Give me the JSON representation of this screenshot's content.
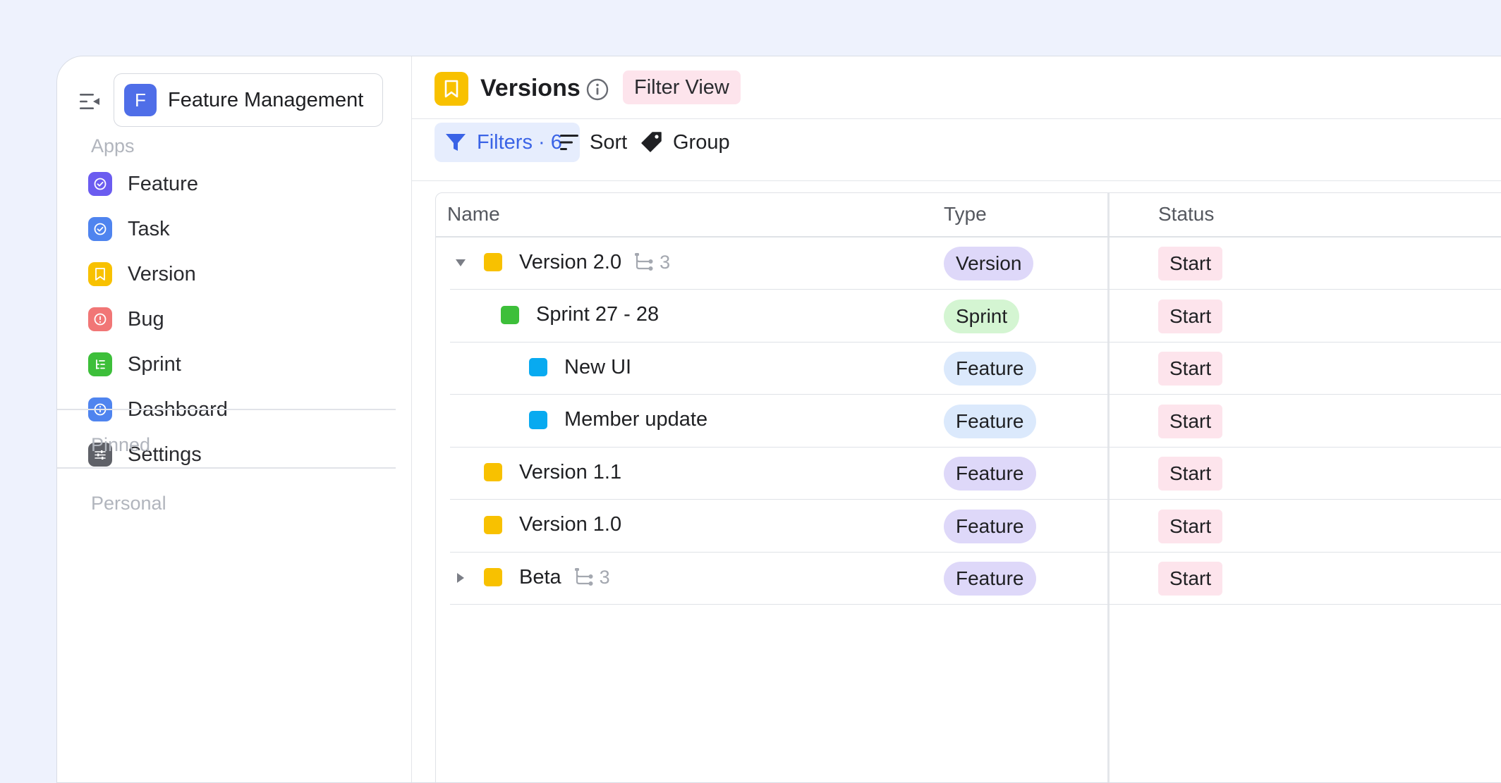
{
  "workspace": {
    "initial": "F",
    "name": "Feature Management"
  },
  "sidebar": {
    "apps_label": "Apps",
    "items": [
      {
        "label": "Feature",
        "icon": "check-circle-icon",
        "color": "#6b5cf0"
      },
      {
        "label": "Task",
        "icon": "check-circle-icon",
        "color": "#4f84ef"
      },
      {
        "label": "Version",
        "icon": "bookmark-icon",
        "color": "#f8c100"
      },
      {
        "label": "Bug",
        "icon": "alert-circle-icon",
        "color": "#f17676"
      },
      {
        "label": "Sprint",
        "icon": "sprint-list-icon",
        "color": "#3dbf3a"
      },
      {
        "label": "Dashboard",
        "icon": "info-circle-icon",
        "color": "#4f84ef"
      },
      {
        "label": "Settings",
        "icon": "sliders-icon",
        "color": "#5f6168"
      }
    ],
    "pinned_label": "Pinned",
    "personal_label": "Personal"
  },
  "header": {
    "title": "Versions",
    "filter_view": "Filter View"
  },
  "toolbar": {
    "filters": "Filters · 6",
    "sort": "Sort",
    "group": "Group"
  },
  "table": {
    "columns": [
      "Name",
      "Type",
      "Status"
    ],
    "rows": [
      {
        "name": "Version 2.0",
        "square": "#f8c100",
        "expanded": true,
        "subcount": "3",
        "type": "Version",
        "type_color": "#ded8f9",
        "status": "Start"
      },
      {
        "name": "Sprint 27 - 28",
        "square": "#3dbf3a",
        "type": "Sprint",
        "type_color": "#d4f5d2",
        "status": "Start"
      },
      {
        "name": "New UI",
        "square": "#08aaf0",
        "type": "Feature",
        "type_color": "#dbe9fc",
        "status": "Start"
      },
      {
        "name": "Member update",
        "square": "#08aaf0",
        "type": "Feature",
        "type_color": "#dbe9fc",
        "status": "Start"
      },
      {
        "name": "Version 1.1",
        "square": "#f8c100",
        "type": "Feature",
        "type_color": "#ded8f9",
        "status": "Start"
      },
      {
        "name": "Version 1.0",
        "square": "#f8c100",
        "type": "Feature",
        "type_color": "#ded8f9",
        "status": "Start"
      },
      {
        "name": "Beta",
        "square": "#f8c100",
        "expanded": false,
        "subcount": "3",
        "type": "Feature",
        "type_color": "#ded8f9",
        "status": "Start"
      }
    ]
  }
}
